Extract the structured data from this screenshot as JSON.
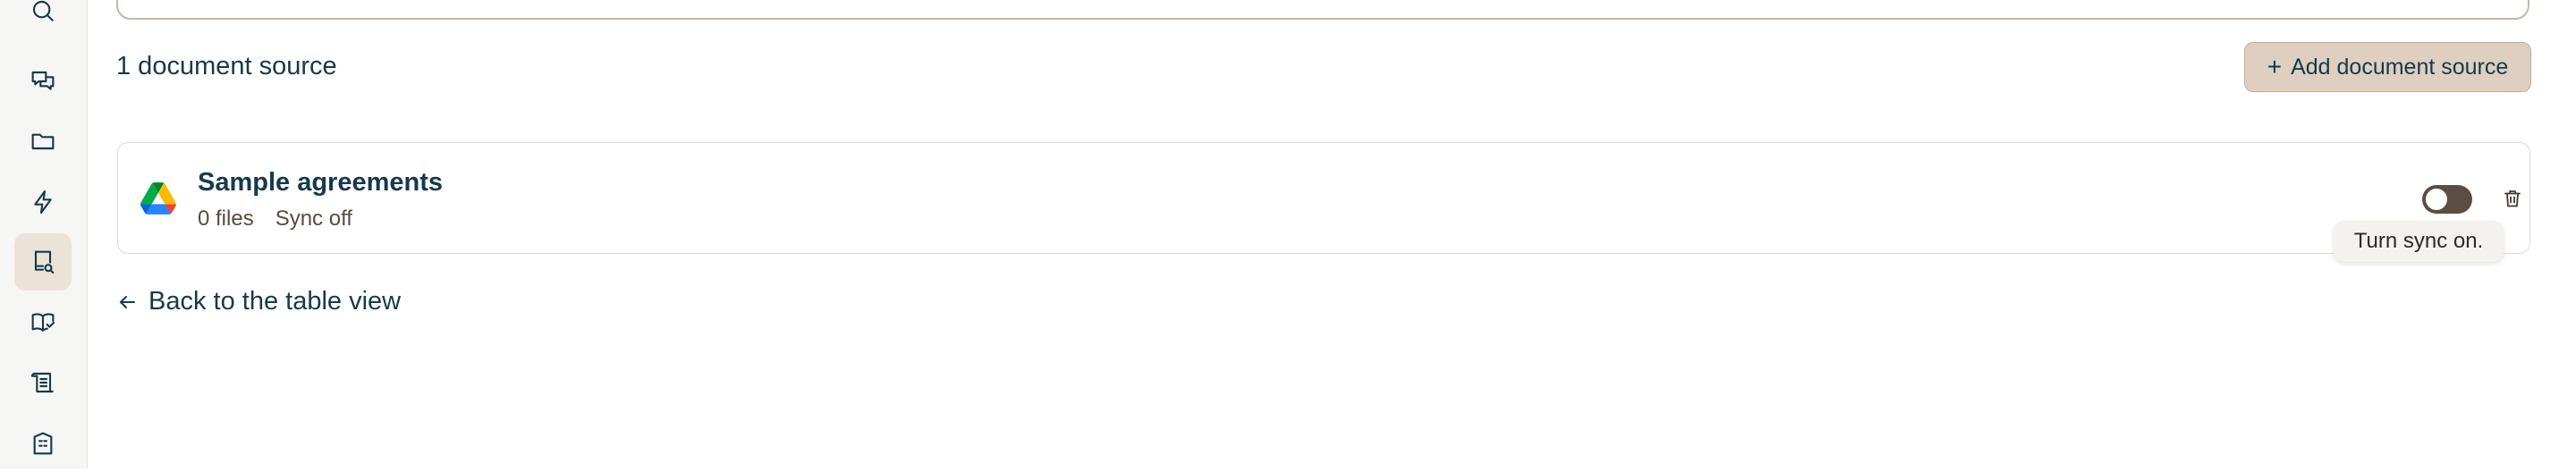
{
  "sidebar": {
    "items": [
      {
        "name": "search-icon",
        "active": false
      },
      {
        "name": "chat-icon",
        "active": false
      },
      {
        "name": "folder-icon",
        "active": false
      },
      {
        "name": "lightning-icon",
        "active": false
      },
      {
        "name": "document-search-icon",
        "active": true
      },
      {
        "name": "book-check-icon",
        "active": false
      },
      {
        "name": "scroll-icon",
        "active": false
      },
      {
        "name": "building-icon",
        "active": false
      }
    ]
  },
  "main": {
    "source_count": "1 document source",
    "add_button_label": "Add document source",
    "add_button_icon": "+",
    "source": {
      "name": "Sample agreements",
      "files": "0 files",
      "sync_status": "Sync off",
      "provider_icon": "google-drive-icon",
      "sync_enabled": false
    },
    "tooltip": "Turn sync on.",
    "back_link": "Back to the table view"
  },
  "colors": {
    "accent_button_bg": "#decfc0",
    "accent_button_border": "#c4ad97",
    "text_primary": "#163a4a",
    "toggle_off": "#5a4d42",
    "active_nav_bg": "#ece3d8"
  }
}
